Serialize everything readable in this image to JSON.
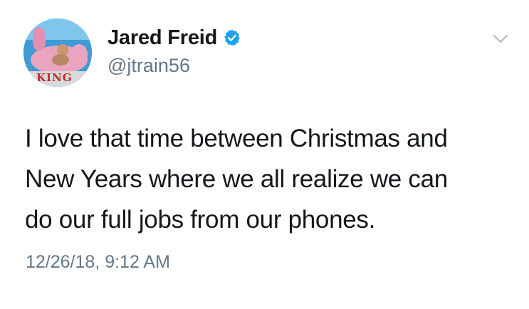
{
  "author": {
    "display_name": "Jared Freid",
    "handle": "@jtrain56",
    "verified": true,
    "avatar_badge_text": "KING"
  },
  "tweet": {
    "text_lines": [
      "I love that time between Christmas and",
      "New Years where we all realize we can",
      "do our full jobs from our phones."
    ],
    "timestamp": "12/26/18, 9:12 AM"
  },
  "icons": {
    "verified": "verified-badge-icon",
    "menu": "chevron-down-icon"
  },
  "colors": {
    "verified_blue": "#1da1f2",
    "secondary_text": "#657786",
    "primary_text": "#14171a"
  }
}
